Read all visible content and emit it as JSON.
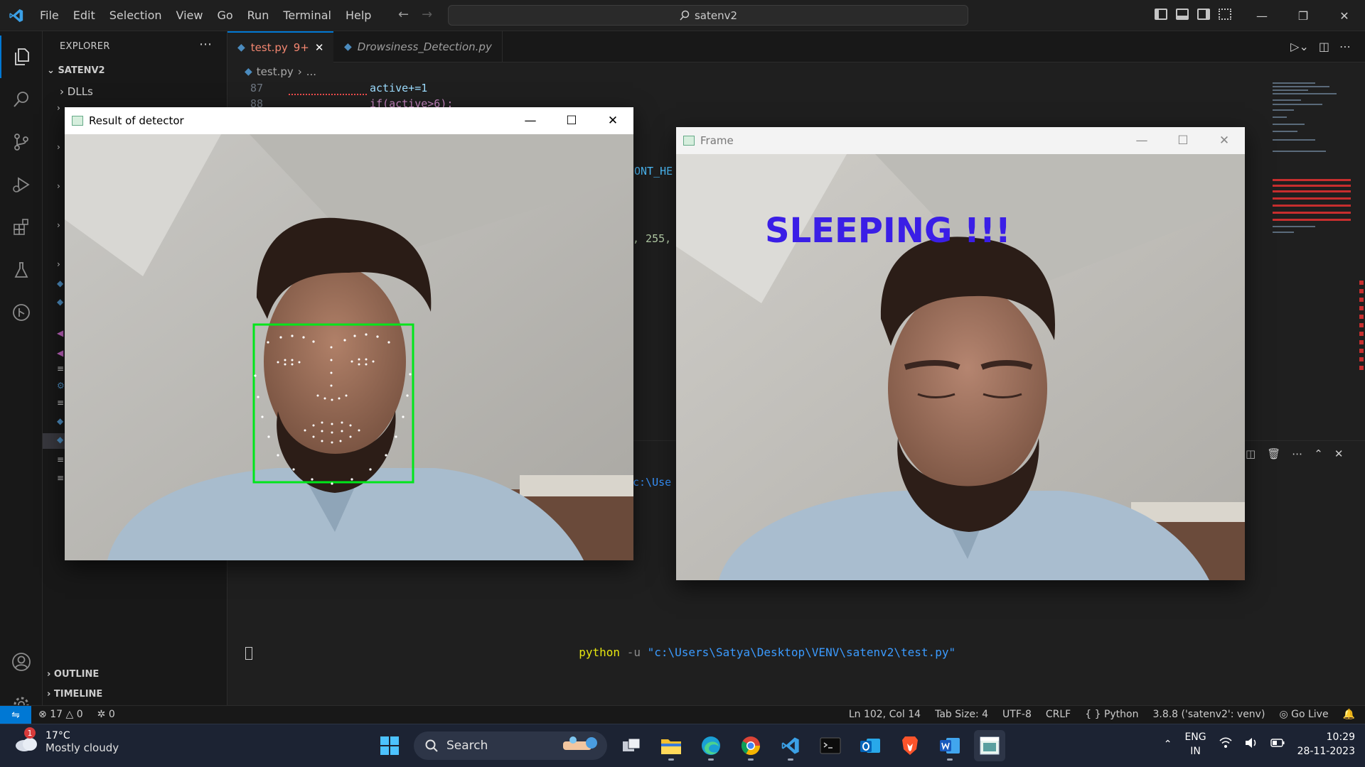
{
  "titlebar": {
    "menu": [
      "File",
      "Edit",
      "Selection",
      "View",
      "Go",
      "Run",
      "Terminal",
      "Help"
    ],
    "search_text": "satenv2"
  },
  "sidebar": {
    "title": "EXPLORER",
    "root": "SATENV2",
    "first_item": "DLLs",
    "outline": "OUTLINE",
    "timeline": "TIMELINE"
  },
  "tabs": [
    {
      "label": "test.py",
      "badge": "9+",
      "active": true
    },
    {
      "label": "Drowsiness_Detection.py",
      "active": false
    }
  ],
  "breadcrumb": {
    "file": "test.py",
    "rest": "..."
  },
  "code": {
    "lines": [
      {
        "num": "87",
        "text": "active+=1"
      },
      {
        "num": "88",
        "text": "if(active>6):"
      }
    ],
    "frag_font": "ONT_HE",
    "frag_num": ", 255,",
    "frag_path": "c:\\Use"
  },
  "terminal": {
    "cmd": "python",
    "flag": "-u",
    "path": "\"c:\\Users\\Satya\\Desktop\\VENV\\satenv2\\test.py\""
  },
  "statusbar": {
    "errors": "17",
    "warnings": "0",
    "ports": "0",
    "position": "Ln 102, Col 14",
    "tab_size": "Tab Size: 4",
    "encoding": "UTF-8",
    "eol": "CRLF",
    "language": "Python",
    "interpreter": "3.8.8 ('satenv2': venv)",
    "golive": "Go Live"
  },
  "detector_window": {
    "title": "Result of detector"
  },
  "frame_window": {
    "title": "Frame",
    "overlay_text": "SLEEPING !!!"
  },
  "taskbar": {
    "weather_badge": "1",
    "temp": "17°C",
    "condition": "Mostly cloudy",
    "search": "Search",
    "lang1": "ENG",
    "lang2": "IN",
    "time": "10:29",
    "date": "28-11-2023"
  },
  "colors": {
    "accent": "#0078d4",
    "face_box": "#00e61a",
    "sleep_text": "#3a1ee6"
  }
}
